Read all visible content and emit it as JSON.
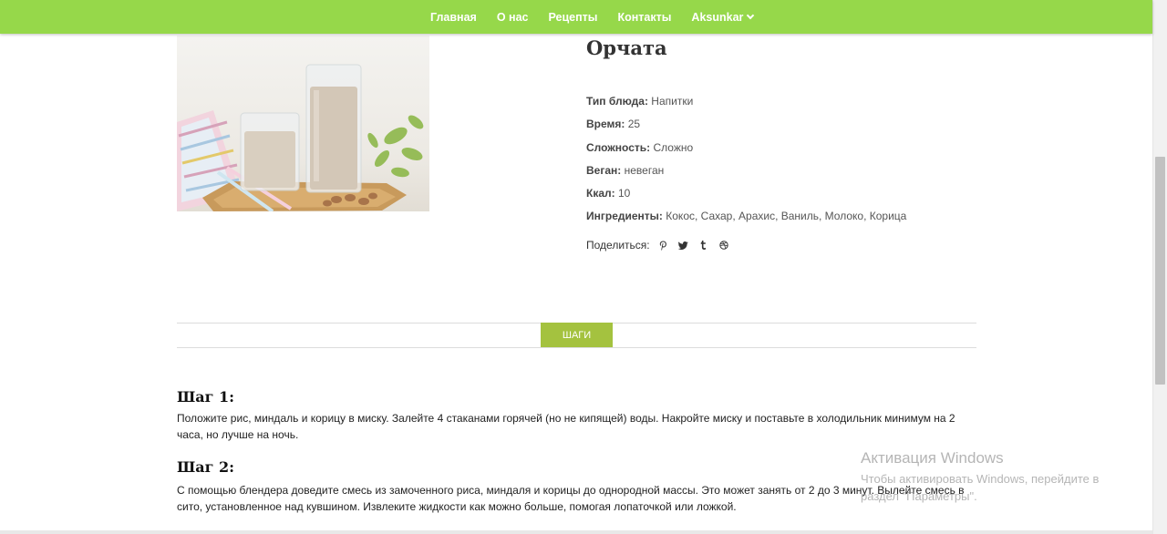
{
  "nav": {
    "items": [
      "Главная",
      "О нас",
      "Рецепты",
      "Контакты"
    ],
    "user": "Aksunkar",
    "color": "#96d84a"
  },
  "recipe": {
    "title": "Орчата",
    "photo_icon": "horchata-glasses-image",
    "meta": [
      {
        "label": "Тип блюда:",
        "value": "Напитки"
      },
      {
        "label": "Время:",
        "value": "25"
      },
      {
        "label": "Сложность:",
        "value": "Сложно"
      },
      {
        "label": "Веган:",
        "value": "невеган"
      },
      {
        "label": "Ккал:",
        "value": "10"
      },
      {
        "label": "Ингредиенты:",
        "value": "Кокос, Сахар, Арахис, Ваниль, Молоко, Корица"
      }
    ],
    "share_label": "Поделиться:",
    "share_icons": [
      "pinterest-icon",
      "twitter-icon",
      "tumblr-icon",
      "dribbble-icon"
    ]
  },
  "tabs": {
    "steps_label": "ШАГИ",
    "accent": "#a4c23f"
  },
  "steps": [
    {
      "title": "Шаг 1:",
      "text": "Положите рис, миндаль и корицу в миску. Залейте 4 стаканами горячей (но не кипящей) воды. Накройте миску и поставьте в холодильник минимум на 2 часа, но лучше на ночь."
    },
    {
      "title": "Шаг 2:",
      "text": "С помощью блендера доведите смесь из замоченного риса, миндаля и корицы до однородной массы. Это может занять от 2 до 3 минут. Вылейте смесь в сито, установленное над кувшином. Извлеките жидкости как можно больше, помогая лопаточкой или ложкой."
    }
  ],
  "watermark": {
    "title": "Активация Windows",
    "text": "Чтобы активировать Windows, перейдите в раздел \"Параметры\"."
  }
}
